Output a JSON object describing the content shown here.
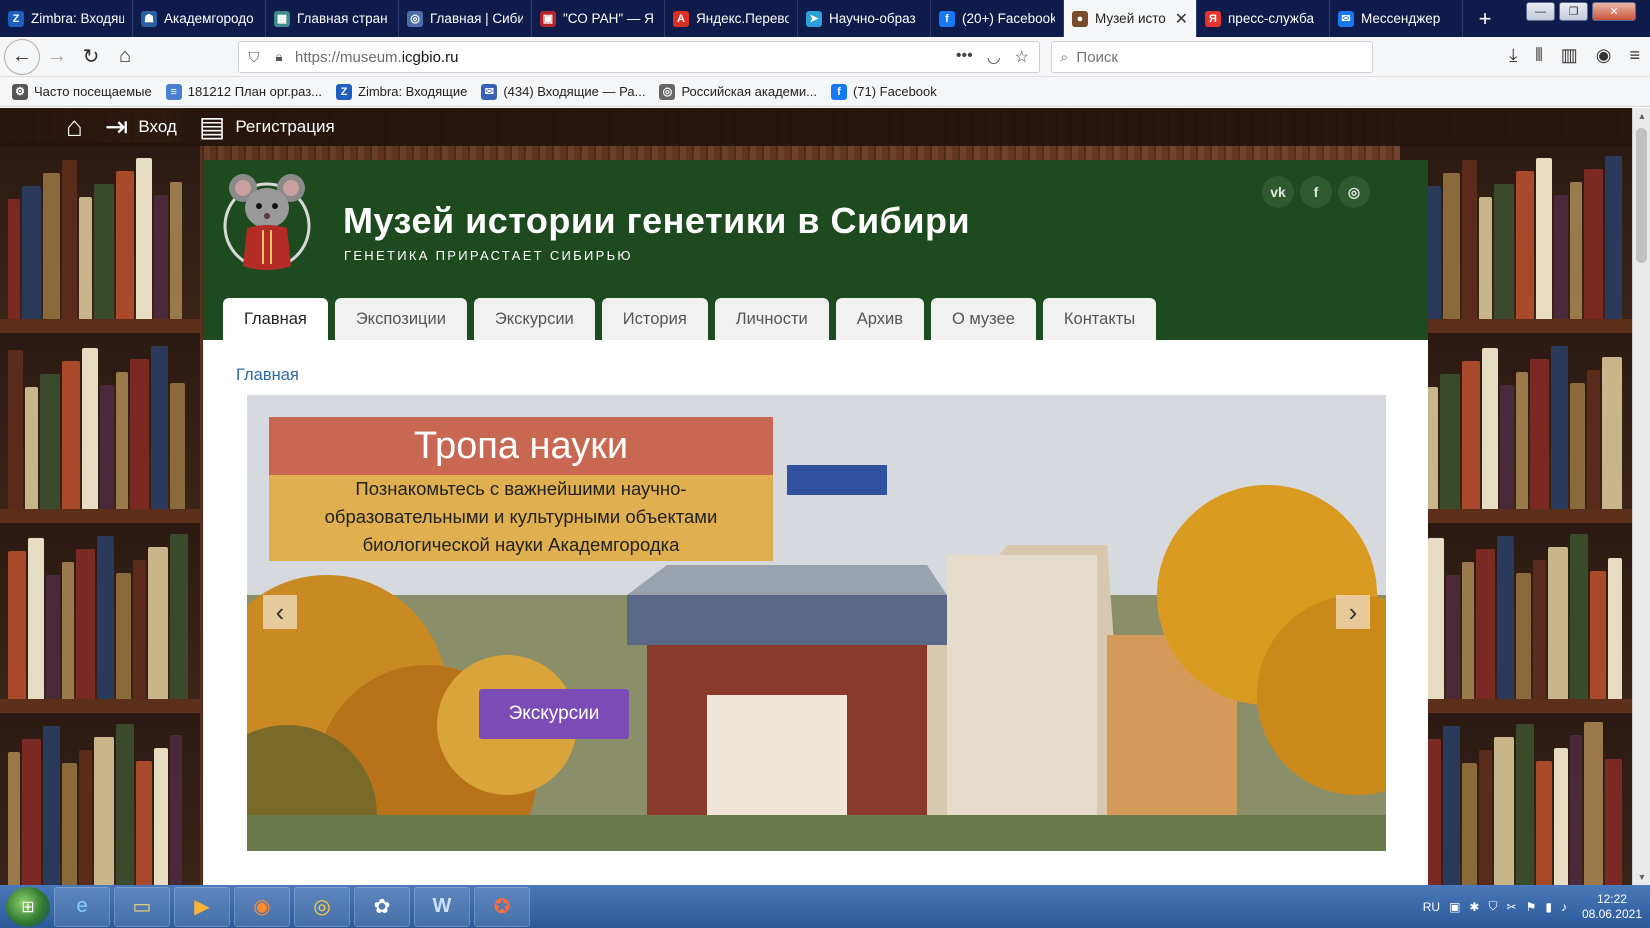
{
  "browser": {
    "tabs": [
      {
        "label": "Zimbra: Входящ",
        "icon": "zimbra-icon",
        "color": "#1d5fbd",
        "glyph": "Z"
      },
      {
        "label": "Академгородо",
        "icon": "hat-icon",
        "color": "#2a5fa0",
        "glyph": "☗"
      },
      {
        "label": "Главная стран",
        "icon": "page-icon",
        "color": "#3d8a8a",
        "glyph": "▦"
      },
      {
        "label": "Главная | Сиби",
        "icon": "globe-icon",
        "color": "#4c6fa8",
        "glyph": "◎"
      },
      {
        "label": "\"СО РАН\" — Я",
        "icon": "ras-icon",
        "color": "#b3262d",
        "glyph": "▣"
      },
      {
        "label": "Яндекс.Перево",
        "icon": "translate-icon",
        "color": "#d93025",
        "glyph": "A"
      },
      {
        "label": "Научно-образ",
        "icon": "telegram-icon",
        "color": "#2aa0d8",
        "glyph": "➤"
      },
      {
        "label": "(20+) Facebook",
        "icon": "facebook-icon",
        "color": "#1877f2",
        "glyph": "f"
      },
      {
        "label": "Музей исто",
        "icon": "museum-icon",
        "color": "#7a4a2c",
        "glyph": "●",
        "active": true
      },
      {
        "label": "пресс-служба",
        "icon": "yandex-icon",
        "color": "#e3342f",
        "glyph": "Я"
      },
      {
        "label": "Мессенджер",
        "icon": "messenger-icon",
        "color": "#1877f2",
        "glyph": "✉"
      }
    ],
    "address": {
      "prefix": "https://museum.",
      "domain": "icgbio.ru"
    },
    "search_placeholder": "Поиск",
    "bookmarks": [
      {
        "label": "Часто посещаемые",
        "icon": "gear-icon",
        "color": "#555555",
        "glyph": "⚙"
      },
      {
        "label": "181212 План орг.раз...",
        "icon": "doc-icon",
        "color": "#4a7fd4",
        "glyph": "≡"
      },
      {
        "label": "Zimbra: Входящие",
        "icon": "zimbra-icon",
        "color": "#1d5fbd",
        "glyph": "Z"
      },
      {
        "label": "(434) Входящие — Ра...",
        "icon": "mail-icon",
        "color": "#3760b8",
        "glyph": "✉"
      },
      {
        "label": "Российская академи...",
        "icon": "globe-icon",
        "color": "#666666",
        "glyph": "◎"
      },
      {
        "label": "(71) Facebook",
        "icon": "facebook-icon",
        "color": "#1877f2",
        "glyph": "f"
      }
    ]
  },
  "site": {
    "topnav": {
      "login": "Вход",
      "register": "Регистрация"
    },
    "title": "Музей истории генетики в Сибири",
    "tagline": "ГЕНЕТИКА ПРИРАСТАЕТ СИБИРЬЮ",
    "socials": [
      "vk",
      "f",
      "ig"
    ],
    "menu": [
      "Главная",
      "Экспозиции",
      "Экскурсии",
      "История",
      "Личности",
      "Архив",
      "О музее",
      "Контакты"
    ],
    "breadcrumb": "Главная",
    "slide": {
      "title": "Тропа науки",
      "text": "Познакомьтесь с важнейшими научно-образовательными и культурными объектами биологической науки Академгородка",
      "button": "Экскурсии"
    }
  },
  "taskbar": {
    "lang": "RU",
    "time": "12:22",
    "date": "08.06.2021"
  },
  "colors": {
    "header_green": "#1e4a20",
    "caption_title": "#c5543a",
    "caption_text": "#e2a837",
    "button_purple": "#7b4bb6",
    "link_blue": "#2b6aa6"
  }
}
